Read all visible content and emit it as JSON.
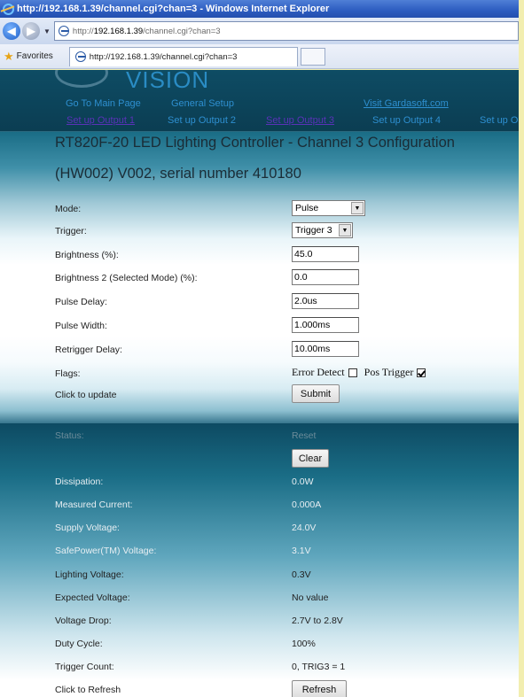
{
  "window": {
    "title": "http://192.168.1.39/channel.cgi?chan=3 - Windows Internet Explorer"
  },
  "address_bar": {
    "prefix": "http://",
    "host": "192.168.1.39",
    "path": "/channel.cgi?chan=3"
  },
  "favorites_bar": {
    "label": "Favorites",
    "tab_title": "http://192.168.1.39/channel.cgi?chan=3"
  },
  "header": {
    "logo_text": "VISION",
    "links": {
      "main_page": "Go To Main Page",
      "general_setup": "General Setup",
      "visit": "Visit Gardasoft.com",
      "output1": "Set up Output 1",
      "output2": "Set up Output 2",
      "output3": "Set up Output 3",
      "output4": "Set up Output 4",
      "output5": "Set up O"
    }
  },
  "page": {
    "title_line1": "RT820F-20 LED Lighting Controller - Channel 3 Configuration",
    "title_line2": "(HW002) V002, serial number 410180"
  },
  "config": {
    "mode_label": "Mode:",
    "mode_value": "Pulse",
    "trigger_label": "Trigger:",
    "trigger_value": "Trigger 3",
    "brightness_label": "Brightness (%):",
    "brightness_value": "45.0",
    "brightness2_label": "Brightness 2 (Selected Mode) (%):",
    "brightness2_value": "0.0",
    "pulse_delay_label": "Pulse Delay:",
    "pulse_delay_value": "2.0us",
    "pulse_width_label": "Pulse Width:",
    "pulse_width_value": "1.000ms",
    "retrigger_label": "Retrigger Delay:",
    "retrigger_value": "10.00ms",
    "flags_label": "Flags:",
    "flag_error_detect": "Error Detect",
    "flag_error_detect_checked": false,
    "flag_pos_trigger": "Pos Trigger",
    "flag_pos_trigger_checked": true,
    "update_label": "Click to update",
    "submit_label": "Submit"
  },
  "status": {
    "status_label": "Status:",
    "status_value": "Reset",
    "clear_label": "Clear",
    "dissipation_label": "Dissipation:",
    "dissipation_value": "0.0W",
    "current_label": "Measured Current:",
    "current_value": "0.000A",
    "supply_label": "Supply Voltage:",
    "supply_value": "24.0V",
    "safepower_label": "SafePower(TM) Voltage:",
    "safepower_value": "3.1V",
    "lighting_label": "Lighting Voltage:",
    "lighting_value": "0.3V",
    "expected_label": "Expected Voltage:",
    "expected_value": "No value",
    "drop_label": "Voltage Drop:",
    "drop_value": "2.7V to 2.8V",
    "duty_label": "Duty Cycle:",
    "duty_value": "100%",
    "trigger_count_label": "Trigger Count:",
    "trigger_count_value": "0, TRIG3 = 1",
    "refresh_label": "Click to Refresh",
    "refresh_button": "Refresh"
  }
}
